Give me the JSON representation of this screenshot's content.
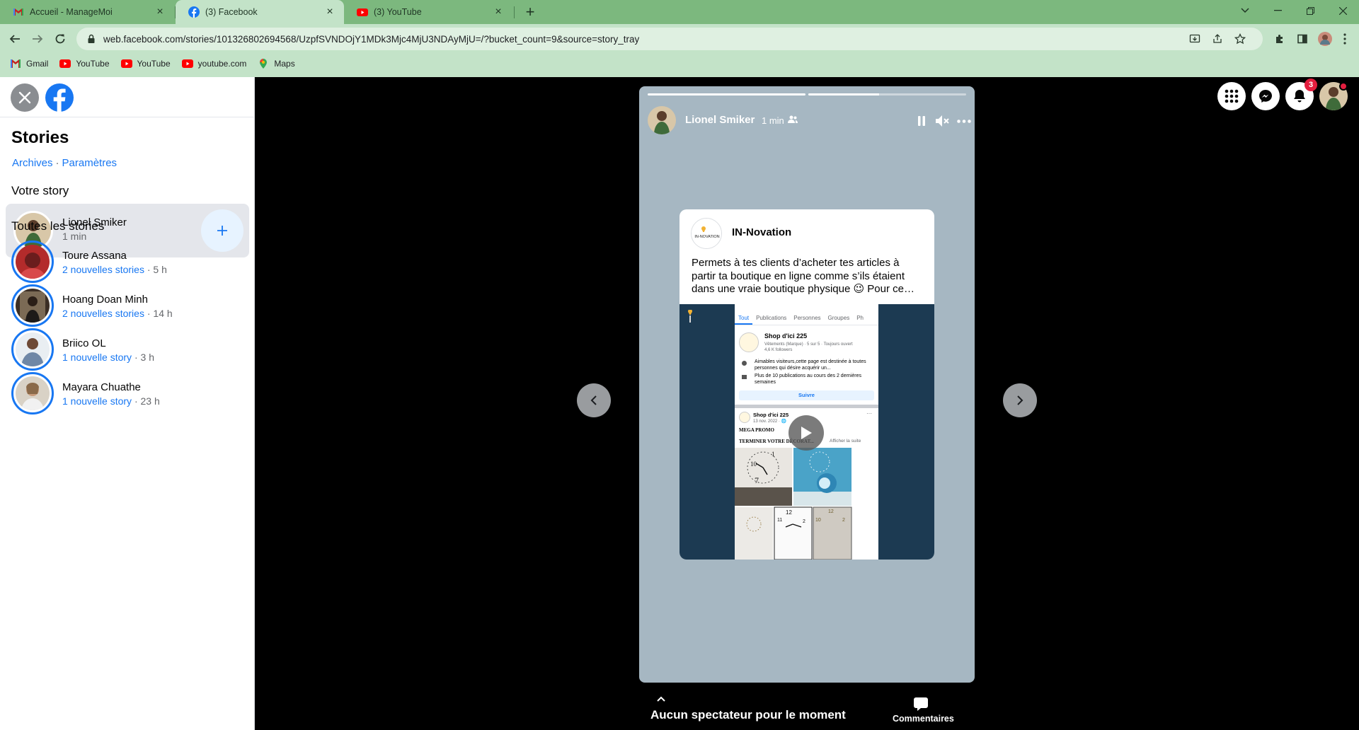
{
  "browser": {
    "tabs": [
      {
        "title": "Accueil - ManageMoi",
        "icon": "gmail-icon"
      },
      {
        "title": "(3) Facebook",
        "icon": "facebook-icon"
      },
      {
        "title": "(3) YouTube",
        "icon": "youtube-icon"
      }
    ],
    "url": "web.facebook.com/stories/101326802694568/UzpfSVNDOjY1MDk3Mjc4MjU3NDAyMjU=/?bucket_count=9&source=story_tray",
    "bookmarks": [
      {
        "label": "Gmail",
        "icon": "gmail-icon"
      },
      {
        "label": "YouTube",
        "icon": "youtube-icon"
      },
      {
        "label": "YouTube",
        "icon": "youtube-icon"
      },
      {
        "label": "youtube.com",
        "icon": "youtube-icon"
      },
      {
        "label": "Maps",
        "icon": "maps-icon"
      }
    ],
    "accent": "#7cb87e"
  },
  "sidebar": {
    "title": "Stories",
    "links": [
      "Archives",
      "Paramètres"
    ],
    "your_story_heading": "Votre story",
    "your_story": {
      "name": "Lionel Smiker",
      "time": "1 min"
    },
    "all_stories_heading": "Toutes les stories",
    "stories": [
      {
        "name": "Toure Assana",
        "new": "2 nouvelles stories",
        "time": "5 h"
      },
      {
        "name": "Hoang Doan Minh",
        "new": "2 nouvelles stories",
        "time": "14 h"
      },
      {
        "name": "Briico OL",
        "new": "1 nouvelle story",
        "time": "3 h"
      },
      {
        "name": "Mayara Chuathe",
        "new": "1 nouvelle story",
        "time": "23 h"
      }
    ]
  },
  "viewer": {
    "progress": [
      1.0,
      0.45
    ],
    "author": "Lionel Smiker",
    "time": "1 min",
    "post": {
      "page_name": "IN-Novation",
      "logo_text": "IN-NOVATION",
      "text": "Permets à tes clients d’acheter tes articles à partir ta boutique en ligne comme s’ils étaient dans une vraie boutique physique 😉 Pour ce…",
      "screenshot": {
        "tabs": [
          "Tout",
          "Publications",
          "Personnes",
          "Groupes",
          "Ph"
        ],
        "shop_name": "Shop d'ici 225",
        "shop_meta": "Vêtements (Marque) · 5 sur 5 · Toujours ouvert",
        "shop_followers": "4,6 K followers",
        "info1": "Aimables visiteurs,cette page est destinée à toutes personnes qui désire acquérir un...",
        "info2": "Plus de 10 publications au cours des 2 dernières semaines",
        "follow": "Suivre",
        "post_author": "Shop d'ici 225",
        "post_date": "13 nov. 2022 · 🌐",
        "promo": "MEGA PROMO",
        "promo2": "TERMINER VOTRE DÉCORAT...",
        "more": "Afficher la suite"
      }
    },
    "notifications_badge": "3",
    "bottom": {
      "viewers": "Aucun spectateur pour le moment",
      "comments": "Commentaires"
    }
  }
}
